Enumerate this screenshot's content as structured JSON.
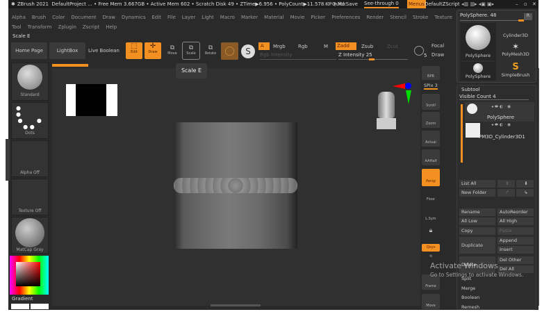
{
  "title_bar": {
    "app": "ZBrush 2021",
    "status": "DefaultProject  ...  • Free Mem 3.667GB • Active Mem 602 • Scratch Disk 49 • ZTime▶6.956 • PolyCount▶11.578 KP • Mc",
    "ac": "AC",
    "quicksave": "QuickSave",
    "see_through": "See-through  0",
    "menus": "Menus",
    "default_zscript": "DefaultZScript"
  },
  "menu_row1": [
    "Alpha",
    "Brush",
    "Color",
    "Document",
    "Draw",
    "Dynamics",
    "Edit",
    "File",
    "Layer",
    "Light",
    "Macro",
    "Marker",
    "Material",
    "Movie",
    "Picker",
    "Preferences",
    "Render",
    "Stencil",
    "Stroke",
    "Texture"
  ],
  "menu_row2": [
    "Tool",
    "Transform",
    "Zplugin",
    "Zscript",
    "Help"
  ],
  "status_label": "Scale E",
  "toolbar": {
    "home_page": "Home Page",
    "lightbox": "LightBox",
    "live_boolean": "Live Boolean",
    "edit": "Edit",
    "draw": "Draw",
    "move": "Move",
    "scale": "Scale",
    "rotate": "Rotate",
    "a": "A",
    "mrgb": "Mrgb",
    "rgb": "Rgb",
    "m": "M",
    "rgb_intensity": "Rgb Intensity",
    "zadd": "Zadd",
    "zsub": "Zsub",
    "zcut": "Zcut",
    "z_intensity": "Z Intensity 25",
    "focal": "Focal",
    "draw_size": "Draw",
    "brush_num": "5"
  },
  "tooltip": "Scale  E",
  "left_shelf": {
    "brush": "Standard",
    "stroke": "Dots",
    "alpha": "Alpha Off",
    "texture": "Texture Off",
    "material": "MatCap Gray",
    "gradient": "Gradient"
  },
  "right_shelf": {
    "bpr": "BPR",
    "spix": "SPix 3",
    "scroll": "Scroll",
    "zoom": "Zoom",
    "actual": "Actual",
    "aahalf": "AAHalf",
    "persp": "Persp",
    "floor": "Floor",
    "lsym": "L.Sym",
    "qxyz": "Qxyz",
    "frame": "Frame",
    "move": "Move"
  },
  "tool_panel": {
    "current": "PolySphere. 48",
    "r": "R",
    "tools": [
      "PolySphere",
      "Cylinder3D",
      "PolyMesh3D",
      "PolySphere",
      "SimpleBrush"
    ]
  },
  "subtool": {
    "header": "Subtool",
    "visible_count": "Visible Count 4",
    "items": [
      "PolySphere",
      "PM3D_Cylinder3D1"
    ],
    "buttons": {
      "list_all": "List All",
      "new_folder": "New Folder",
      "rename": "Rename",
      "auto_reorder": "AutoReorder",
      "all_low": "All Low",
      "all_high": "All High",
      "copy": "Copy",
      "paste": "Paste",
      "duplicate": "Duplicate",
      "append": "Append",
      "insert": "Insert",
      "delete": "Delete",
      "del_other": "Del Other",
      "del_all": "Del All",
      "split": "Split",
      "merge": "Merge",
      "boolean": "Boolean",
      "remesh": "Remesh"
    }
  },
  "watermark": {
    "title": "Activate Windows",
    "subtitle": "Go to Settings to activate Windows."
  },
  "colors": {
    "accent": "#f29022",
    "canvas": "#303030",
    "panel": "#2a2a2a"
  }
}
